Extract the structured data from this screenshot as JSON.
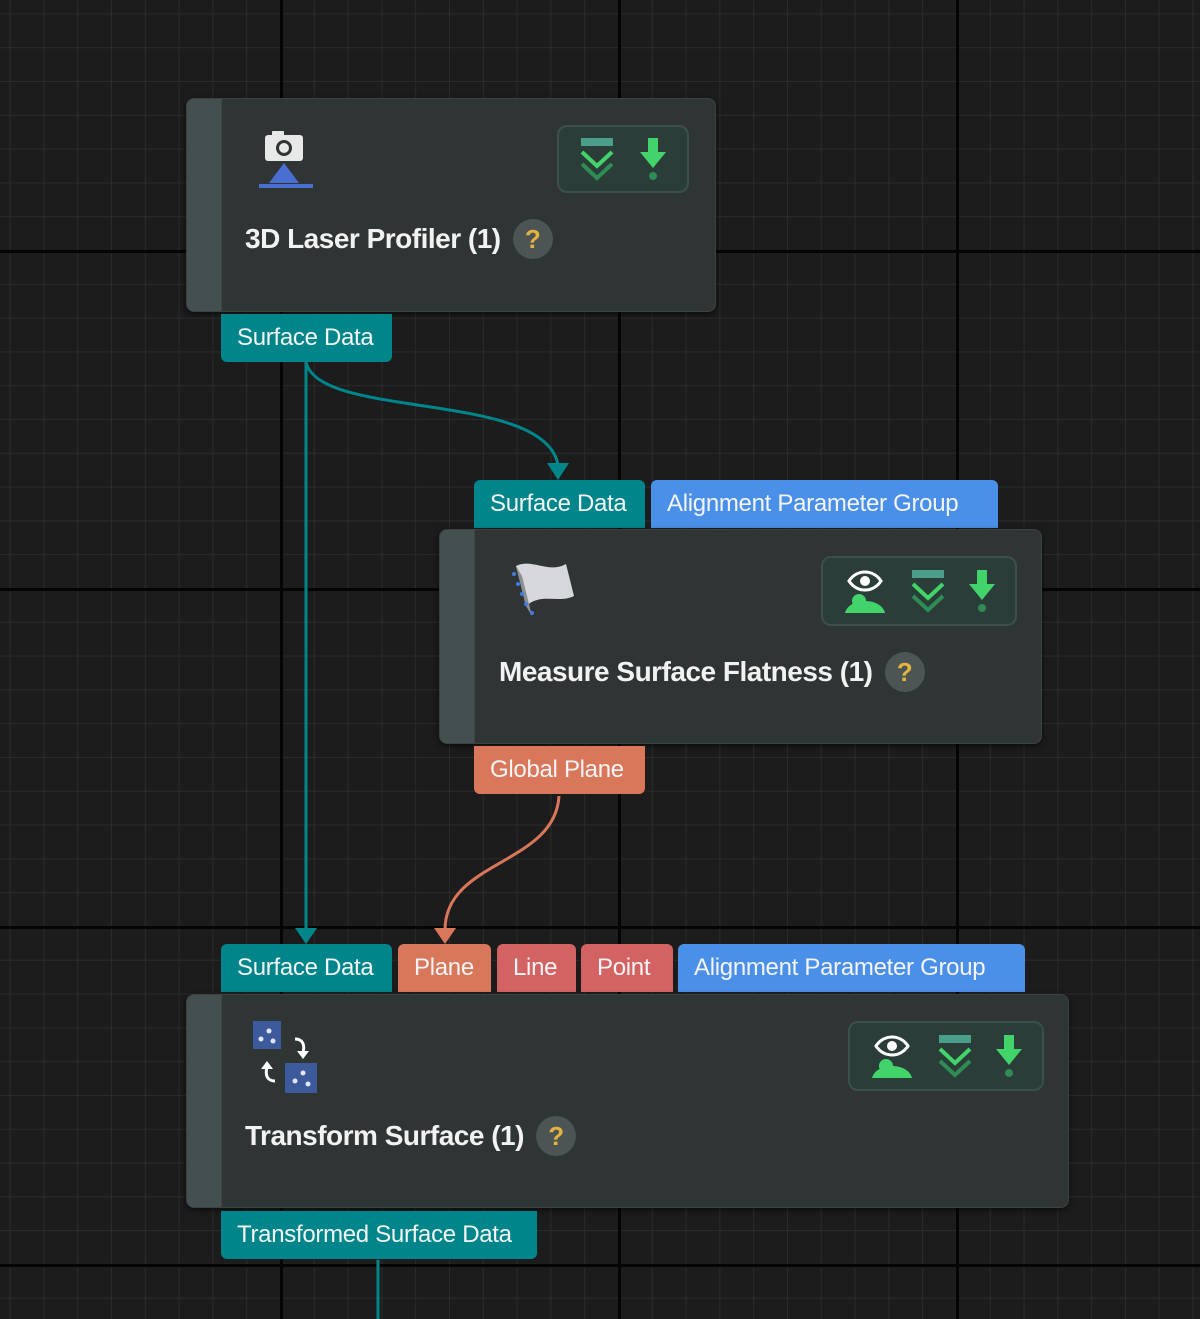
{
  "colors": {
    "background": "#1c1c1c",
    "node": "#2f3535",
    "port_surface": "#00868a",
    "port_alignment": "#4a8fe8",
    "port_plane": "#d9775b",
    "port_line_point": "#d36363",
    "wire_surface": "#00868a",
    "wire_plane": "#d9775b",
    "help_icon": "#e3b341",
    "action_icon": "#43d36b"
  },
  "nodes": [
    {
      "title": "3D Laser Profiler (1)",
      "help": "?",
      "icon": "camera-icon",
      "actions": [
        "collapse-chevron-icon",
        "download-icon"
      ],
      "outputs": [
        "Surface Data"
      ]
    },
    {
      "title": "Measure Surface Flatness (1)",
      "help": "?",
      "icon": "surface-flatness-icon",
      "actions": [
        "visibility-eye-icon",
        "collapse-chevron-icon",
        "download-icon"
      ],
      "inputs": [
        "Surface Data",
        "Alignment Parameter Group"
      ],
      "outputs": [
        "Global Plane"
      ]
    },
    {
      "title": "Transform Surface (1)",
      "help": "?",
      "icon": "transform-icon",
      "actions": [
        "visibility-eye-icon",
        "collapse-chevron-icon",
        "download-icon"
      ],
      "inputs": [
        "Surface Data",
        "Plane",
        "Line",
        "Point",
        "Alignment Parameter Group"
      ],
      "outputs": [
        "Transformed Surface Data"
      ]
    }
  ]
}
